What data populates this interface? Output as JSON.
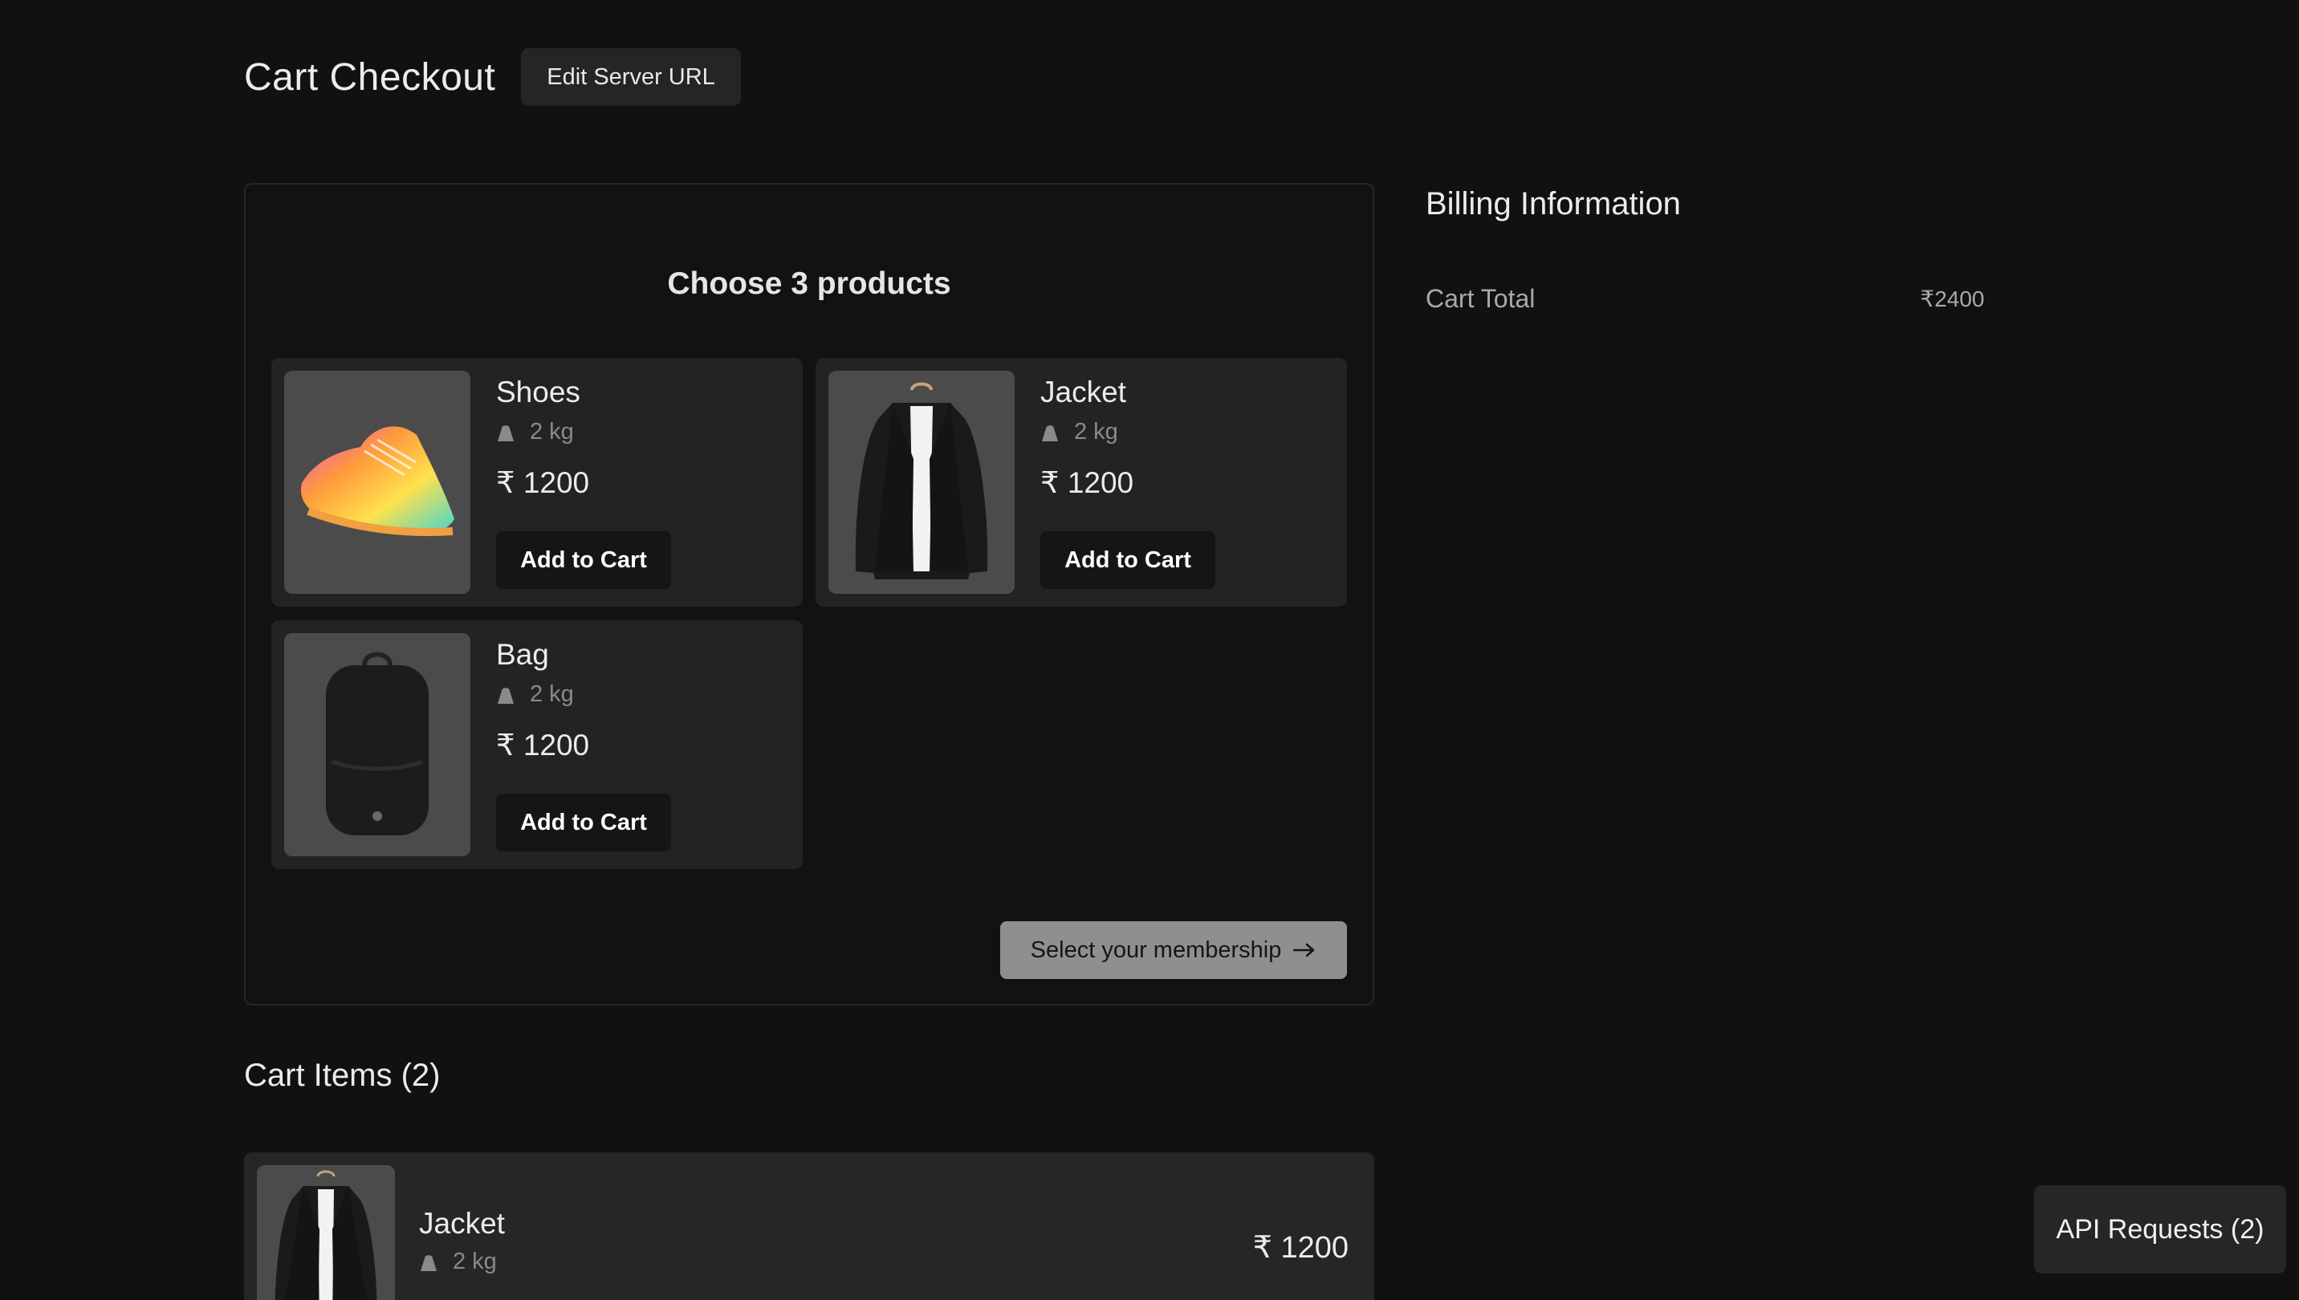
{
  "header": {
    "title": "Cart Checkout",
    "edit_server_label": "Edit Server URL"
  },
  "products_panel": {
    "heading": "Choose 3 products",
    "products": [
      {
        "name": "Shoes",
        "weight": "2 kg",
        "price": "₹ 1200",
        "button": "Add to Cart",
        "image": "colorful-sneaker-image"
      },
      {
        "name": "Jacket",
        "weight": "2 kg",
        "price": "₹ 1200",
        "button": "Add to Cart",
        "image": "black-jacket-image"
      },
      {
        "name": "Bag",
        "weight": "2 kg",
        "price": "₹ 1200",
        "button": "Add to Cart",
        "image": "black-backpack-image"
      }
    ],
    "membership_button": "Select your membership"
  },
  "cart": {
    "heading": "Cart Items (2)",
    "items": [
      {
        "name": "Jacket",
        "weight": "2 kg",
        "price": "₹ 1200",
        "image": "black-jacket-image"
      }
    ]
  },
  "billing": {
    "title": "Billing Information",
    "total_label": "Cart Total",
    "total_value": "₹2400"
  },
  "api_requests_label": "API Requests (2)",
  "icons": {
    "weight": "bag-weight-icon",
    "arrow": "arrow-right-icon"
  },
  "colors": {
    "background": "#111111",
    "card": "#232323",
    "membership_button": "#8f8f8f"
  }
}
